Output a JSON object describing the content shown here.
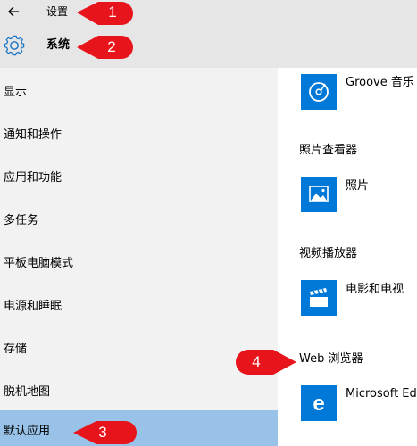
{
  "titlebar": {
    "title": "设置"
  },
  "header": {
    "title": "系统"
  },
  "sidebar": {
    "items": [
      {
        "label": "显示"
      },
      {
        "label": "通知和操作"
      },
      {
        "label": "应用和功能"
      },
      {
        "label": "多任务"
      },
      {
        "label": "平板电脑模式"
      },
      {
        "label": "电源和睡眠"
      },
      {
        "label": "存储"
      },
      {
        "label": "脱机地图"
      },
      {
        "label": "默认应用"
      }
    ],
    "selected": "默认应用"
  },
  "main": {
    "music_player": {
      "app": "Groove 音乐"
    },
    "photo_viewer": {
      "title": "照片查看器",
      "app": "照片"
    },
    "video_player": {
      "title": "视频播放器",
      "app": "电影和电视"
    },
    "web_browser": {
      "title": "Web 浏览器",
      "app": "Microsoft Edge"
    }
  },
  "annotations": [
    "1",
    "2",
    "3",
    "4"
  ],
  "colors": {
    "accent": "#0078d7",
    "selected_bg": "#98c2e7",
    "callout": "#e8141b",
    "header_bg": "#e6e6e6",
    "sidebar_bg": "#f2f2f2"
  }
}
